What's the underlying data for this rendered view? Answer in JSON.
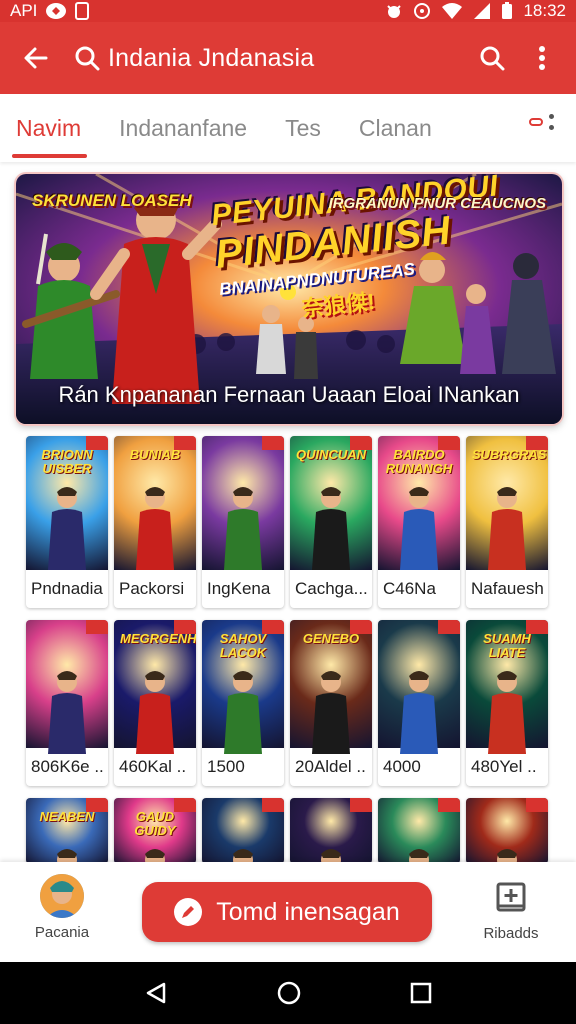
{
  "status_bar": {
    "left_text": "API",
    "time": "18:32"
  },
  "app_bar": {
    "search_query": "Indania Jndanasia",
    "icons": [
      "back-arrow-icon",
      "search-icon",
      "search-icon",
      "more-vert-icon"
    ]
  },
  "tabs": [
    {
      "label": "Navim",
      "active": true
    },
    {
      "label": "Indananfane",
      "active": false
    },
    {
      "label": "Tes",
      "active": false
    },
    {
      "label": "Clanan",
      "active": false
    }
  ],
  "banner": {
    "tag_left": "SKRUNEN LOASEH",
    "headline_1": "PEYUINA BANDOUI",
    "headline_2": "PINDANIISH",
    "headline_3": "BNAINAPNDNUTUREAS",
    "headline_4": "奈狼傑!",
    "tag_right": "IRGRANUN PNUR CEAUCNOS",
    "caption": "Rán Knpananan Fernaan Uaaan  Eloai INankan"
  },
  "grid_rows": [
    [
      {
        "label": "Pndnadia",
        "title": "BRIONN UISBER"
      },
      {
        "label": "Packorsi",
        "title": "BUNIAB"
      },
      {
        "label": "IngKena",
        "title": ""
      },
      {
        "label": "Cachga...",
        "title": "QUINCUAN"
      },
      {
        "label": "C46Na",
        "title": "BAIRDO RUNANGH"
      },
      {
        "label": "Nafauesh",
        "title": "SUBRGRAS"
      }
    ],
    [
      {
        "label": "806K6e ..",
        "title": ""
      },
      {
        "label": "460Kal ..",
        "title": "MEGRGENHE"
      },
      {
        "label": "1500",
        "title": "SAHOV LACOK"
      },
      {
        "label": "20Aldel ..",
        "title": "GENEBO"
      },
      {
        "label": "4000",
        "title": ""
      },
      {
        "label": "480Yel ..",
        "title": "SUAMH LIATE"
      }
    ],
    [
      {
        "label": "",
        "title": "NEABEN"
      },
      {
        "label": "",
        "title": "GAUD GUIDY"
      },
      {
        "label": "",
        "title": ""
      },
      {
        "label": "",
        "title": ""
      },
      {
        "label": "",
        "title": ""
      },
      {
        "label": "",
        "title": ""
      }
    ]
  ],
  "bottom_bar": {
    "profile_label": "Pacania",
    "cta_label": "Tomd inensagan",
    "saved_label": "Ribadds"
  },
  "colors": {
    "primary": "#de3b36",
    "status_bar": "#d8332f",
    "tab_inactive": "#8a8a8a"
  }
}
